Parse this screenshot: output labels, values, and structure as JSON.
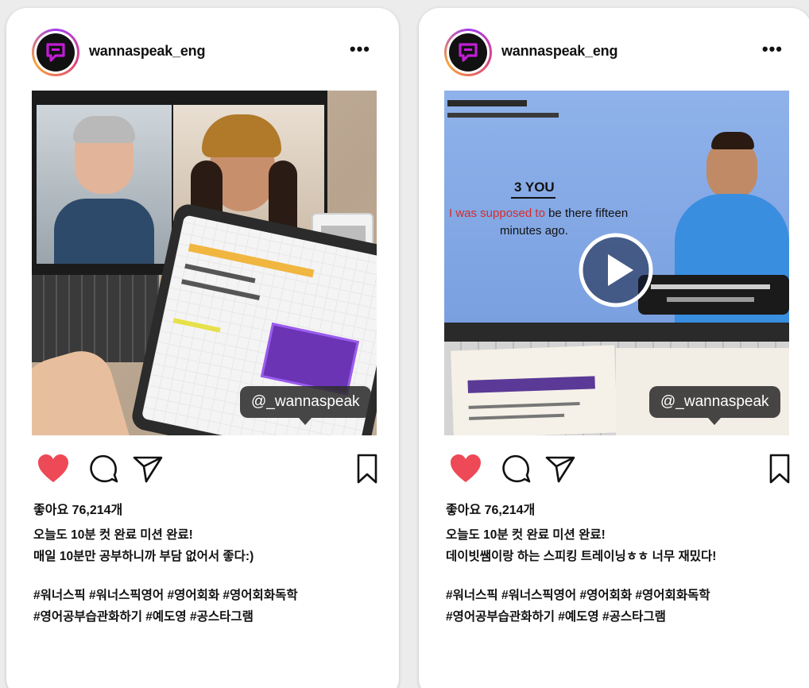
{
  "posts": [
    {
      "username": "wannaspeak_eng",
      "more_label": "•••",
      "tooltip": "@_wannaspeak",
      "likes": "좋아요 76,214개",
      "caption": [
        "오늘도 10분 컷 완료 미션 완료!",
        "매일 10분만 공부하니까 부담 없어서 좋다:)"
      ],
      "hashtags": [
        "#워너스픽 #워너스픽영어 #영어회화 #영어회화독학",
        "#영어공부습관화하기 #예도영 #공스타그램"
      ],
      "liked": true
    },
    {
      "username": "wannaspeak_eng",
      "more_label": "•••",
      "tooltip": "@_wannaspeak",
      "likes": "좋아요 76,214개",
      "caption": [
        "오늘도 10분 컷 완료 미션 완료!",
        "데이빗쌤이랑 하는 스피킹 트레이닝ㅎㅎ 너무 재밌다!"
      ],
      "hashtags": [
        "#워너스픽 #워너스픽영어 #영어회화 #영어회화독학",
        "#영어공부습관화하기 #예도영 #공스타그램"
      ],
      "liked": true
    }
  ],
  "video_screen": {
    "heading": "3 YOU",
    "line1_red": "I was supposed to",
    "line1_rest": " be there fifteen",
    "line2": "minutes ago."
  },
  "colors": {
    "heart": "#ed4956",
    "avatar_bubble": "#c21dd6",
    "text": "#111111"
  }
}
